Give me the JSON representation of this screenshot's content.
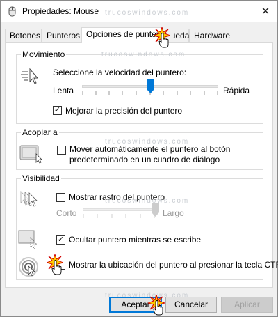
{
  "window": {
    "title": "Propiedades: Mouse",
    "close_symbol": "✕",
    "watermark": "trucoswindows.com"
  },
  "tabs": [
    {
      "label": "Botones"
    },
    {
      "label": "Punteros"
    },
    {
      "label": "Opciones de puntero",
      "active": true
    },
    {
      "label": "Rueda"
    },
    {
      "label": "Hardware"
    }
  ],
  "movement": {
    "title": "Movimiento",
    "speed_label": "Seleccione la velocidad del puntero:",
    "slow_label": "Lenta",
    "fast_label": "Rápida",
    "speed_level": 0.5,
    "precision_label": "Mejorar la precisión del puntero",
    "precision_checked": true,
    "check_mark": "✓"
  },
  "snap_to": {
    "title": "Acoplar a",
    "label_line1": "Mover automáticamente el puntero al botón",
    "label_line2": "predeterminado en un cuadro de diálogo",
    "checked": false
  },
  "visibility": {
    "title": "Visibilidad",
    "trails_label": "Mostrar rastro del puntero",
    "trails_checked": false,
    "short_label": "Corto",
    "long_label": "Largo",
    "trail_level": 1.0,
    "hide_label": "Ocultar puntero mientras se escribe",
    "hide_checked": true,
    "ctrl_label": "Mostrar la ubicación del puntero al presionar la tecla CTRL",
    "ctrl_checked": false
  },
  "buttons": {
    "accept": "Aceptar",
    "cancel": "Cancelar",
    "apply": "Aplicar"
  },
  "colors": {
    "accent": "#0078d7",
    "click_burst": "#ffcc00"
  }
}
